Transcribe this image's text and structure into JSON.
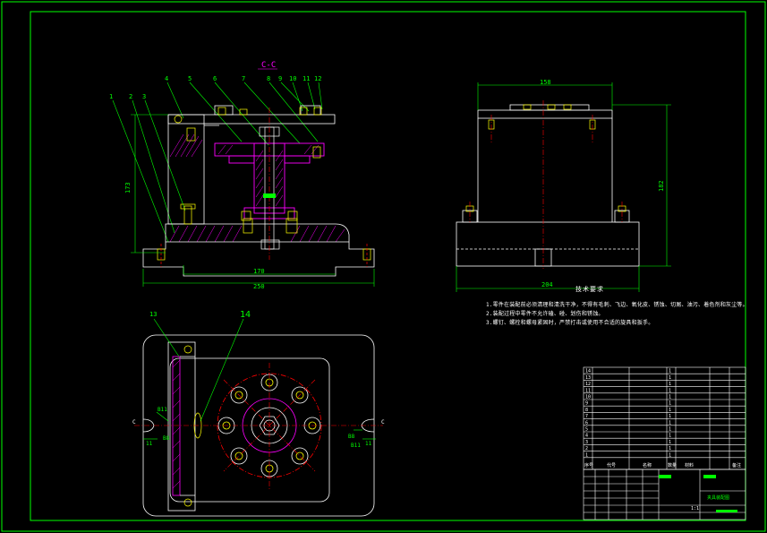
{
  "colors": {
    "background": "#000000",
    "border": "#00ff00",
    "outline": "#ffffff",
    "dimension": "#00ff00",
    "centerline": "#ff0000",
    "component": "#ff00ff",
    "hatch": "#ff00ff",
    "bolt": "#ffff00",
    "leader": "#00ff00"
  },
  "section": {
    "title": "C-C"
  },
  "part_numbers": [
    "1",
    "2",
    "3",
    "4",
    "5",
    "6",
    "7",
    "8",
    "9",
    "10",
    "11",
    "12"
  ],
  "plan_part_numbers": [
    "13",
    "14"
  ],
  "dimensions": {
    "front_height": "173",
    "front_inner_width": "170",
    "front_overall_width": "250",
    "side_top_width": "158",
    "side_height": "182",
    "side_base_width": "204"
  },
  "plan_labels": {
    "left_section": "C",
    "right_section": "C",
    "left_fit": "B11",
    "left_fit2": "B8",
    "right_fit": "B8",
    "right_fit2": "B11",
    "left_mark": "11",
    "right_mark": "11"
  },
  "technical_requirements": {
    "title": "技术要求",
    "items": [
      "1.零件在装配前必须清理和清洗干净，不得有毛刺、飞边、氧化皮、锈蚀、切屑、油污、着色剂和灰尘等。",
      "2.装配过程中零件不允许磕、碰、划伤和锈蚀。",
      "3.螺钉、螺栓和螺母紧固时，严禁打击或使用不合适的旋具和扳手。"
    ]
  },
  "parts_table": {
    "header": [
      "序号",
      "代号",
      "名称",
      "数量",
      "材料",
      "备注"
    ],
    "row_numbers": [
      "14",
      "13",
      "12",
      "11",
      "10",
      "9",
      "8",
      "7",
      "6",
      "5",
      "4",
      "3",
      "2",
      "1"
    ],
    "row_qty": [
      "1",
      "1",
      "1",
      "1",
      "1",
      "1",
      "1",
      "1",
      "1",
      "1",
      "1",
      "1",
      "1",
      "1"
    ]
  },
  "title_block": {
    "scale": "1:1",
    "name": "夹具装配图"
  }
}
